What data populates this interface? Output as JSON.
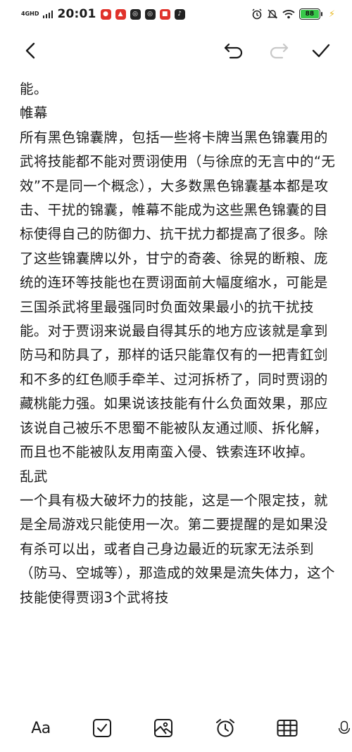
{
  "status_bar": {
    "network": "4GHD",
    "time": "20:01",
    "battery": "88"
  },
  "toolbar": {
    "back_icon": "chevron-left-icon",
    "undo_icon": "undo-icon",
    "redo_icon": "redo-icon",
    "done_icon": "checkmark-icon"
  },
  "note": {
    "paragraphs": [
      "能。",
      "帷幕",
      "所有黑色锦囊牌，包括一些将卡牌当黑色锦囊用的武将技能都不能对贾诩使用（与徐庶的无言中的“无效”不是同一个概念），大多数黑色锦囊基本都是攻击、干扰的锦囊，帷幕不能成为这些黑色锦囊的目标使得自己的防御力、抗干扰力都提高了很多。除了这些锦囊牌以外，甘宁的奇袭、徐晃的断粮、庞统的连环等技能也在贾诩面前大幅度缩水，可能是三国杀武将里最强同时负面效果最小的抗干扰技能。对于贾诩来说最自得其乐的地方应该就是拿到防马和防具了，那样的话只能靠仅有的一把青釭剑和不多的红色顺手牵羊、过河拆桥了，同时贾诩的藏桃能力强。如果说该技能有什么负面效果，那应该说自己被乐不思蜀不能被队友通过顺、拆化解，而且也不能被队友用南蛮入侵、铁索连环收掉。",
      "乱武",
      "一个具有极大破坏力的技能，这是一个限定技，就是全局游戏只能使用一次。第二要提醒的是如果没有杀可以出，或者自己身边最近的玩家无法杀到（防马、空城等），那造成的效果是流失体力，这个技能使得贾诩3个武将技"
    ]
  },
  "bottom_bar": {
    "format_label": "Aa",
    "icons": [
      "text-format-icon",
      "checklist-icon",
      "image-icon",
      "alarm-clock-icon",
      "table-icon",
      "microphone-icon"
    ]
  }
}
